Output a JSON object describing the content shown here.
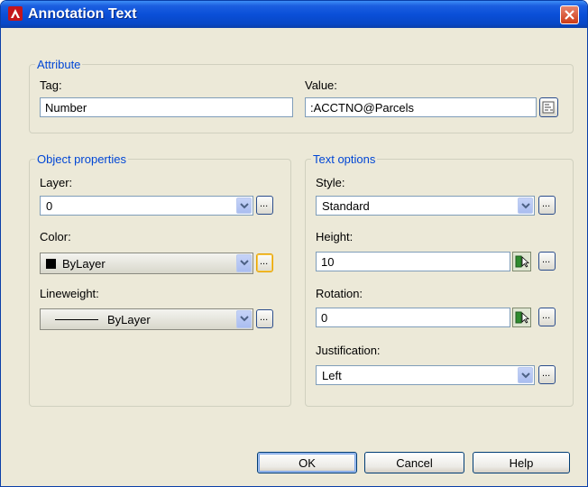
{
  "window": {
    "title": "Annotation Text",
    "colors": {
      "titlebar": "#0a4fd8",
      "legend": "#0046d5",
      "close": "#cd3a16"
    }
  },
  "attribute": {
    "legend": "Attribute",
    "tag_label": "Tag:",
    "tag_value": "Number",
    "value_label": "Value:",
    "value_value": ":ACCTNO@Parcels"
  },
  "object_properties": {
    "legend": "Object properties",
    "layer_label": "Layer:",
    "layer_value": "0",
    "color_label": "Color:",
    "color_value": "ByLayer",
    "lineweight_label": "Lineweight:",
    "lineweight_value": "ByLayer"
  },
  "text_options": {
    "legend": "Text options",
    "style_label": "Style:",
    "style_value": "Standard",
    "height_label": "Height:",
    "height_value": "10",
    "rotation_label": "Rotation:",
    "rotation_value": "0",
    "justification_label": "Justification:",
    "justification_value": "Left"
  },
  "browse_label": "...",
  "buttons": {
    "ok": "OK",
    "cancel": "Cancel",
    "help": "Help"
  },
  "icons": [
    "autocad-logo-icon",
    "close-icon",
    "field-insert-icon",
    "chevron-down-icon",
    "pick-point-icon",
    "color-swatch-icon",
    "line-sample-icon"
  ]
}
